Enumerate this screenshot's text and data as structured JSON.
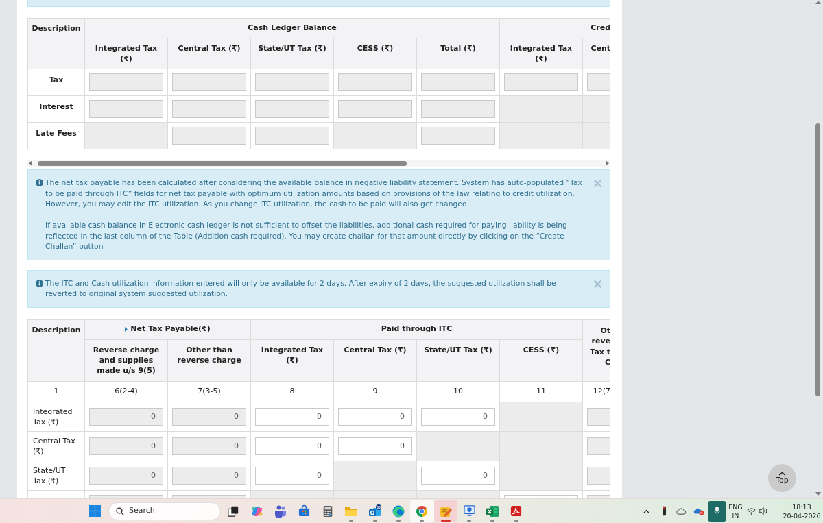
{
  "cash_table": {
    "corner": "Description",
    "groups": [
      {
        "label": "Cash Ledger Balance",
        "columns": [
          "Integrated Tax (₹)",
          "Central Tax (₹)",
          "State/UT Tax (₹)",
          "CESS (₹)",
          "Total (₹)"
        ]
      },
      {
        "label": "Cred",
        "columns": [
          "Integrated Tax (₹)",
          "Cent"
        ]
      }
    ],
    "rows": [
      {
        "label": "Tax",
        "cells": [
          {
            "kind": "readonly"
          },
          {
            "kind": "readonly"
          },
          {
            "kind": "readonly"
          },
          {
            "kind": "readonly"
          },
          {
            "kind": "readonly"
          },
          {
            "kind": "readonly"
          },
          {
            "kind": "readonly"
          }
        ]
      },
      {
        "label": "Interest",
        "cells": [
          {
            "kind": "readonly"
          },
          {
            "kind": "readonly"
          },
          {
            "kind": "readonly"
          },
          {
            "kind": "readonly"
          },
          {
            "kind": "readonly"
          },
          {
            "kind": "blank"
          },
          {
            "kind": "blank"
          }
        ]
      },
      {
        "label": "Late Fees",
        "cells": [
          {
            "kind": "blank"
          },
          {
            "kind": "readonly"
          },
          {
            "kind": "readonly"
          },
          {
            "kind": "blank"
          },
          {
            "kind": "readonly"
          },
          {
            "kind": "blank"
          },
          {
            "kind": "blank"
          }
        ]
      }
    ]
  },
  "alerts": [
    {
      "kind": "info",
      "dismissible": true,
      "paragraphs": [
        "The net tax payable has been calculated after considering the available balance in negative liability statement. System has auto-populated “Tax to be paid through ITC” fields for net tax payable with optimum utilization amounts based on provisions of the law relating to credit utilization. However, you may edit the ITC utilization. As you change ITC utilization, the cash to be paid will also get changed.",
        "If available cash balance in Electronic cash ledger is not sufficient to offset the liabilities, additional cash required for paying liability is being reflected in the last column of the Table (Addition cash required). You may create challan for that amount directly by clicking on the “Create Challan” button"
      ]
    },
    {
      "kind": "info",
      "dismissible": true,
      "paragraphs": [
        "The ITC and Cash utilization information entered will only be available for 2 days. After expiry of 2 days, the suggested utilization shall be reverted to original system suggested utilization."
      ]
    }
  ],
  "net_table": {
    "corner": "Description",
    "groups": [
      {
        "label": "Net Tax Payable(₹)",
        "expanded": false,
        "columns": [
          "Reverse charge and supplies made u/s 9(5)",
          "Other than reverse charge"
        ]
      },
      {
        "label": "Paid through ITC",
        "columns": [
          "Integrated Tax (₹)",
          "Central Tax (₹)",
          "State/UT Tax (₹)",
          "CESS (₹)"
        ]
      },
      {
        "lines": [
          "Ot",
          "reve",
          "Tax t",
          "C"
        ]
      }
    ],
    "index_row": [
      "1",
      "6(2-4)",
      "7(3-5)",
      "8",
      "9",
      "10",
      "11",
      "12(7"
    ],
    "rows": [
      {
        "label": "Integrated Tax (₹)",
        "cells": [
          {
            "kind": "readonly",
            "value": "0"
          },
          {
            "kind": "readonly",
            "value": "0"
          },
          {
            "kind": "input",
            "value": "0"
          },
          {
            "kind": "input",
            "value": "0"
          },
          {
            "kind": "input",
            "value": "0"
          },
          {
            "kind": "blank"
          },
          {
            "kind": "readonly"
          }
        ]
      },
      {
        "label": "Central Tax (₹)",
        "cells": [
          {
            "kind": "readonly",
            "value": "0"
          },
          {
            "kind": "readonly",
            "value": "0"
          },
          {
            "kind": "input",
            "value": "0"
          },
          {
            "kind": "input",
            "value": "0"
          },
          {
            "kind": "blank"
          },
          {
            "kind": "blank"
          },
          {
            "kind": "readonly"
          }
        ]
      },
      {
        "label": "State/UT Tax (₹)",
        "cells": [
          {
            "kind": "readonly",
            "value": "0"
          },
          {
            "kind": "readonly",
            "value": "0"
          },
          {
            "kind": "input",
            "value": "0"
          },
          {
            "kind": "blank"
          },
          {
            "kind": "input",
            "value": "0"
          },
          {
            "kind": "blank"
          },
          {
            "kind": "readonly"
          }
        ]
      },
      {
        "cut_off": true,
        "cells": [
          {
            "kind": "readonly"
          },
          {
            "kind": "readonly"
          },
          {
            "kind": "blank"
          },
          {
            "kind": "blank"
          },
          {
            "kind": "blank"
          },
          {
            "kind": "input"
          },
          {
            "kind": "readonly"
          }
        ]
      }
    ]
  },
  "back_to_top": {
    "label": "Top"
  },
  "taskbar": {
    "search": {
      "placeholder": "Search"
    },
    "apps": [
      {
        "kind": "taskview",
        "running": false,
        "focused": false,
        "hovered": false
      },
      {
        "kind": "copilot",
        "running": false,
        "focused": false,
        "hovered": false
      },
      {
        "kind": "teams",
        "running": false,
        "focused": false,
        "hovered": false
      },
      {
        "kind": "store",
        "running": false,
        "focused": false,
        "hovered": false
      },
      {
        "kind": "calculator",
        "running": false,
        "focused": false,
        "hovered": false
      },
      {
        "kind": "explorer",
        "running": true,
        "focused": false,
        "hovered": false
      },
      {
        "kind": "outlook",
        "running": true,
        "focused": false,
        "hovered": false
      },
      {
        "kind": "edge",
        "running": true,
        "focused": false,
        "hovered": false
      },
      {
        "kind": "chrome",
        "running": true,
        "focused": false,
        "hovered": true
      },
      {
        "kind": "notes",
        "running": true,
        "focused": true,
        "hovered": false
      },
      {
        "kind": "shield",
        "running": true,
        "focused": false,
        "hovered": false
      },
      {
        "kind": "excel",
        "running": true,
        "focused": false,
        "hovered": false
      },
      {
        "kind": "acrobat",
        "running": true,
        "focused": false,
        "hovered": false
      }
    ],
    "tray": {
      "mic_active": true,
      "language": "ENG",
      "region": "IN",
      "time": "18:13",
      "date": "20-04-2026"
    }
  }
}
